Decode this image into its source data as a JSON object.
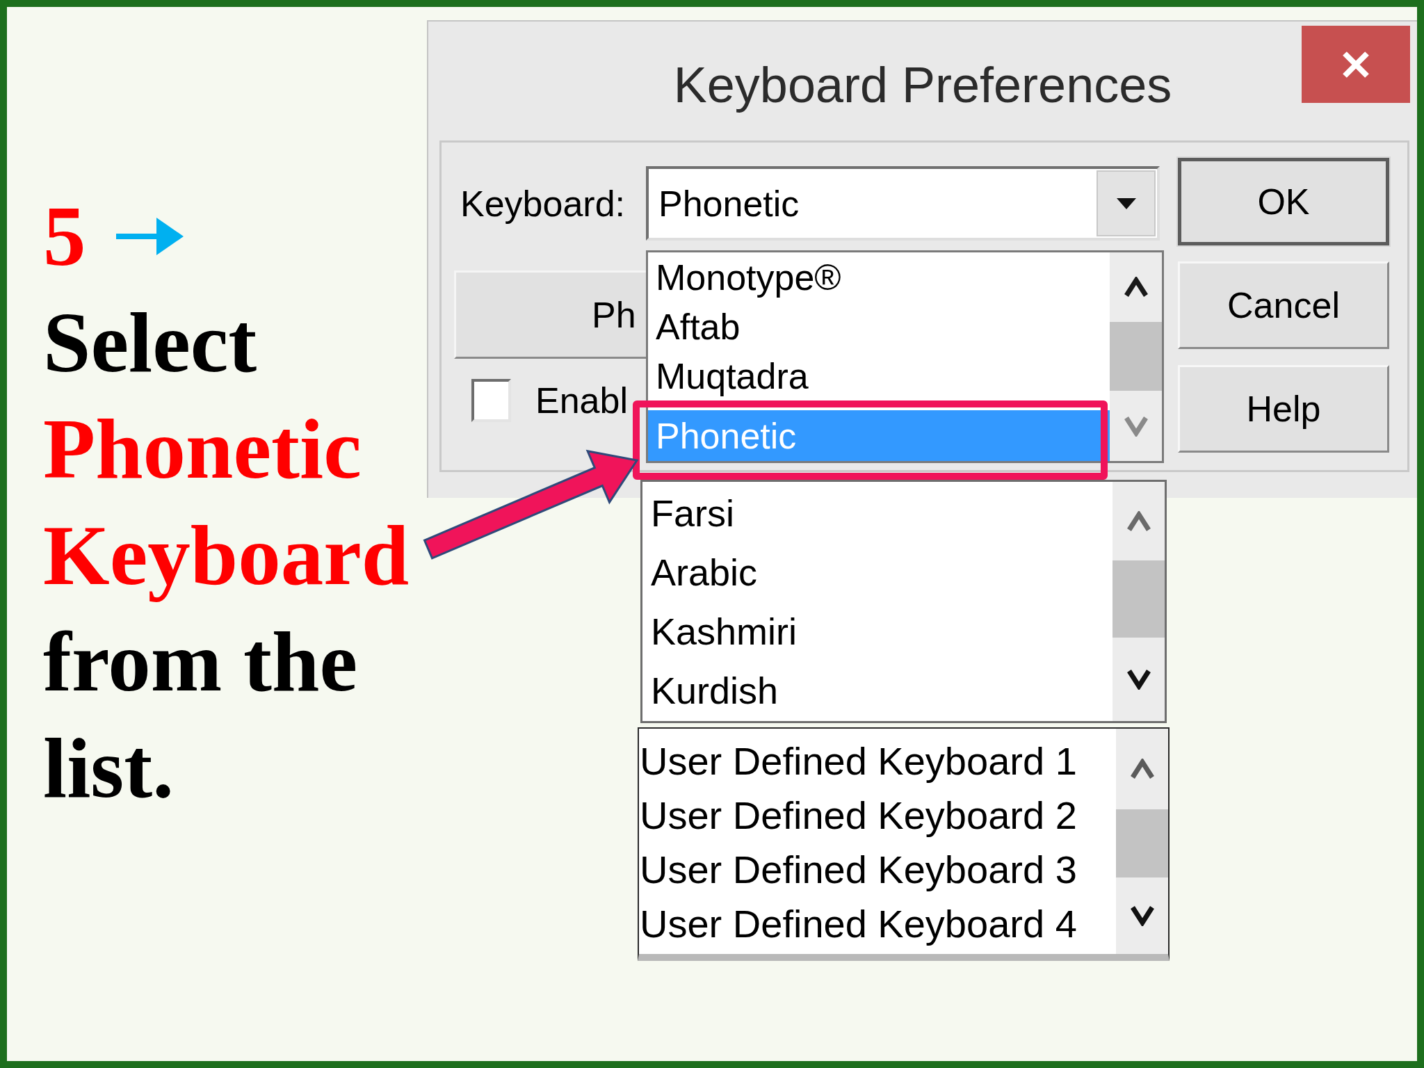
{
  "instruction": {
    "step": "5",
    "parts": [
      {
        "text": "Select",
        "emphasis": false
      },
      {
        "text": "Phonetic Keyboard",
        "emphasis": true
      },
      {
        "text": "from the list.",
        "emphasis": false
      }
    ]
  },
  "dialog": {
    "title": "Keyboard Preferences",
    "keyboard_label": "Keyboard:",
    "keyboard_value": "Phonetic",
    "covered_button": "Ph",
    "checkbox": {
      "label": "Enabl",
      "checked": false
    },
    "buttons": [
      {
        "label": "OK",
        "default": true
      },
      {
        "label": "Cancel",
        "default": false
      },
      {
        "label": "Help",
        "default": false
      }
    ]
  },
  "dropdown_lists": [
    {
      "items": [
        {
          "label": "Monotype®",
          "selected": false
        },
        {
          "label": "Aftab",
          "selected": false
        },
        {
          "label": "Muqtadra",
          "selected": false
        },
        {
          "label": "Phonetic",
          "selected": true
        }
      ]
    },
    {
      "items": [
        {
          "label": "Farsi",
          "selected": false
        },
        {
          "label": "Arabic",
          "selected": false
        },
        {
          "label": "Kashmiri",
          "selected": false
        },
        {
          "label": "Kurdish",
          "selected": false
        }
      ]
    },
    {
      "items": [
        {
          "label": "User Defined Keyboard 1",
          "selected": false
        },
        {
          "label": "User Defined Keyboard 2",
          "selected": false
        },
        {
          "label": "User Defined Keyboard 3",
          "selected": false
        },
        {
          "label": "User Defined Keyboard 4",
          "selected": false
        }
      ]
    }
  ]
}
